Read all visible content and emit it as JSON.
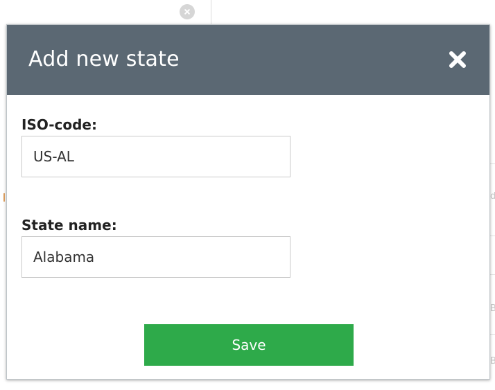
{
  "dialog": {
    "title": "Add new state",
    "close_icon": "close-icon",
    "header_color": "#5b6873"
  },
  "form": {
    "iso_code": {
      "label": "ISO-code:",
      "value": "US-AL"
    },
    "state_name": {
      "label": "State name:",
      "value": "Alabama"
    },
    "save_button": {
      "label": "Save",
      "color": "#2eaa4a"
    }
  },
  "background": {
    "remove_icon": "remove-circle-icon"
  }
}
